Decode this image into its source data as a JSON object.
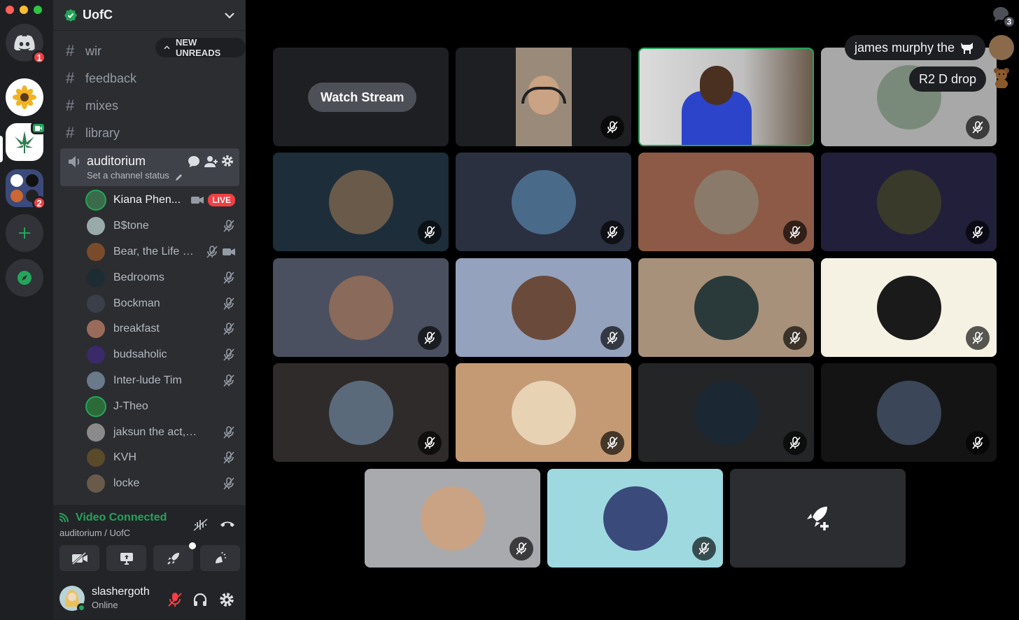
{
  "server": {
    "name": "UofC",
    "badges": {
      "home": "1",
      "folder": "2"
    }
  },
  "unreads_label": "NEW UNREADS",
  "text_channels": [
    {
      "name": "wir"
    },
    {
      "name": "feedback"
    },
    {
      "name": "mixes"
    },
    {
      "name": "library"
    }
  ],
  "voice_channel": {
    "name": "auditorium",
    "status_placeholder": "Set a channel status"
  },
  "members": [
    {
      "name": "Kiana Phen...",
      "live": "LIVE",
      "color": "#3b6b4a"
    },
    {
      "name": "B$tone",
      "color": "#9aa"
    },
    {
      "name": "Bear, the Life C...",
      "color": "#7a4b2a"
    },
    {
      "name": "Bedrooms",
      "color": "#1d2b33"
    },
    {
      "name": "Bockman",
      "color": "#3a3f4a"
    },
    {
      "name": "breakfast",
      "color": "#9a6b5a"
    },
    {
      "name": "budsaholic",
      "color": "#3a2a6a"
    },
    {
      "name": "Inter-lude Tim",
      "color": "#6a7a8a"
    },
    {
      "name": "J-Theo",
      "color": "#2d6a3a"
    },
    {
      "name": "jaksun the act, son",
      "color": "#8a8a8a"
    },
    {
      "name": "KVH",
      "color": "#5a4a2a"
    },
    {
      "name": "locke",
      "color": "#6a5a4a"
    }
  ],
  "rtc": {
    "title": "Video Connected",
    "subtitle": "auditorium / UofC"
  },
  "user": {
    "name": "slashergoth",
    "status": "Online"
  },
  "stage": {
    "watch_stream": "Watch Stream",
    "bubbles": [
      "james murphy the",
      "R2 D drop"
    ],
    "notification_count": "3"
  },
  "tiles": [
    {
      "bg": "#1e1f22"
    },
    {
      "bg": "#1e1f22"
    },
    {
      "bg": "#c7c7c7"
    },
    {
      "bg": "#a8a8a8"
    },
    {
      "bg": "#1d2e3a"
    },
    {
      "bg": "#2a3040"
    },
    {
      "bg": "#8c5a46"
    },
    {
      "bg": "#221f3a"
    },
    {
      "bg": "#4a5060"
    },
    {
      "bg": "#94a2bd"
    },
    {
      "bg": "#a8917a"
    },
    {
      "bg": "#f5f2e3"
    },
    {
      "bg": "#2e2b2a"
    },
    {
      "bg": "#c49a74"
    },
    {
      "bg": "#232526"
    },
    {
      "bg": "#141414"
    },
    {
      "bg": "#a9aaae"
    },
    {
      "bg": "#9fd9e0"
    },
    {
      "bg": "#2b2d31"
    }
  ],
  "colors": {
    "accent_green": "#23a55a",
    "live_red": "#f23f43",
    "brand": "#5865f2"
  }
}
